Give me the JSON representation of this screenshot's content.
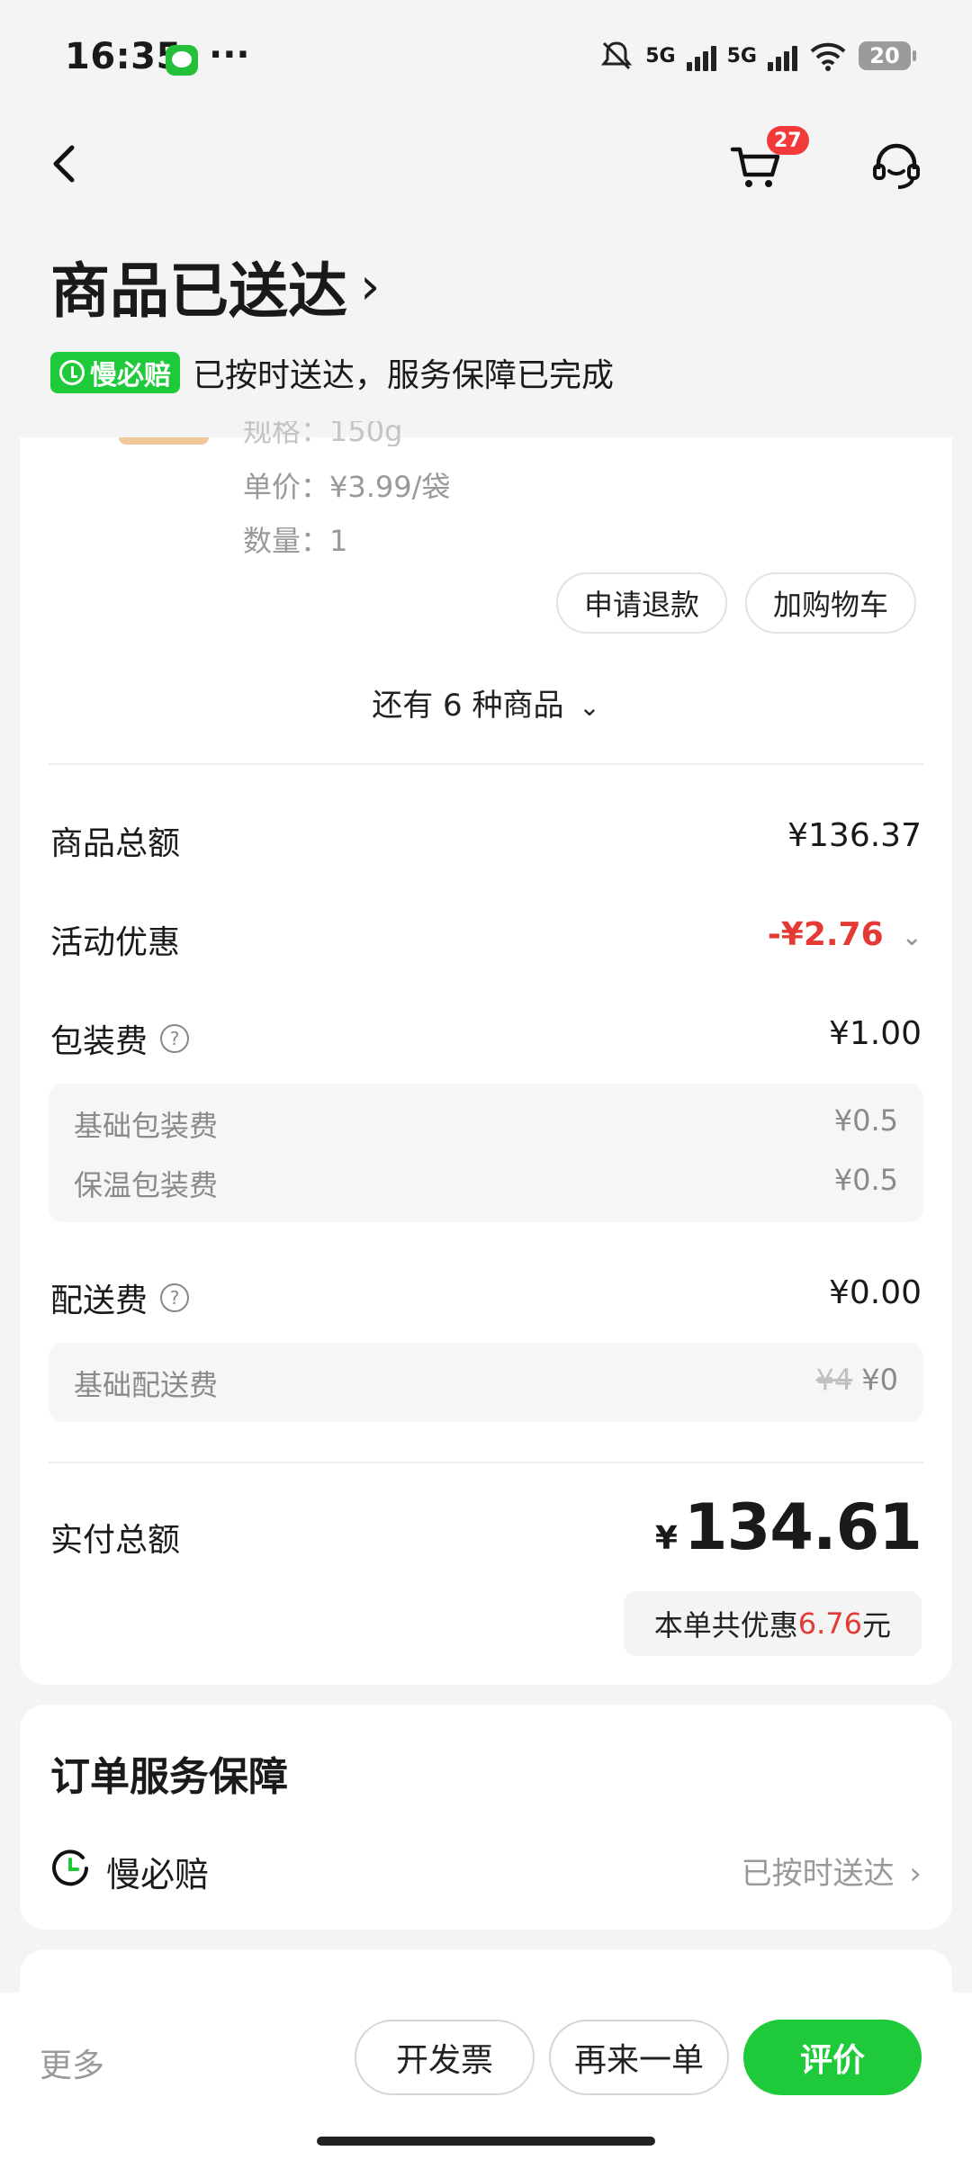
{
  "status_bar": {
    "time": "16:35",
    "network1": "5G",
    "network2": "5G",
    "battery": "20"
  },
  "header": {
    "cart_count": "27"
  },
  "order": {
    "title": "商品已送达",
    "guarantee_tag": "慢必赔",
    "guarantee_text": "已按时送达，服务保障已完成"
  },
  "product": {
    "spec_partial": "规格：150g",
    "unit_price": "单价：¥3.99/袋",
    "quantity": "数量：1",
    "refund_label": "申请退款",
    "add_cart_label": "加购物车"
  },
  "more_items": "还有 6 种商品",
  "fees": {
    "goods_total_label": "商品总额",
    "goods_total_value": "¥136.37",
    "discount_label": "活动优惠",
    "discount_value": "-¥2.76",
    "packing_label": "包装费",
    "packing_value": "¥1.00",
    "packing_items": [
      {
        "label": "基础包装费",
        "value": "¥0.5"
      },
      {
        "label": "保温包装费",
        "value": "¥0.5"
      }
    ],
    "delivery_label": "配送费",
    "delivery_value": "¥0.00",
    "delivery_item_label": "基础配送费",
    "delivery_item_original": "¥4",
    "delivery_item_value": "¥0"
  },
  "total": {
    "label": "实付总额",
    "currency": "¥",
    "amount": "134.61",
    "saved_prefix": "本单共优惠",
    "saved_amount": "6.76",
    "saved_suffix": "元"
  },
  "service_section": {
    "title": "订单服务保障",
    "item_name": "慢必赔",
    "item_status": "已按时送达"
  },
  "bottom_bar": {
    "more": "更多",
    "invoice": "开发票",
    "reorder": "再来一单",
    "review": "评价"
  },
  "colors": {
    "brand_green": "#1fca3a",
    "discount_red": "#e53935",
    "badge_red": "#f23a3a"
  }
}
